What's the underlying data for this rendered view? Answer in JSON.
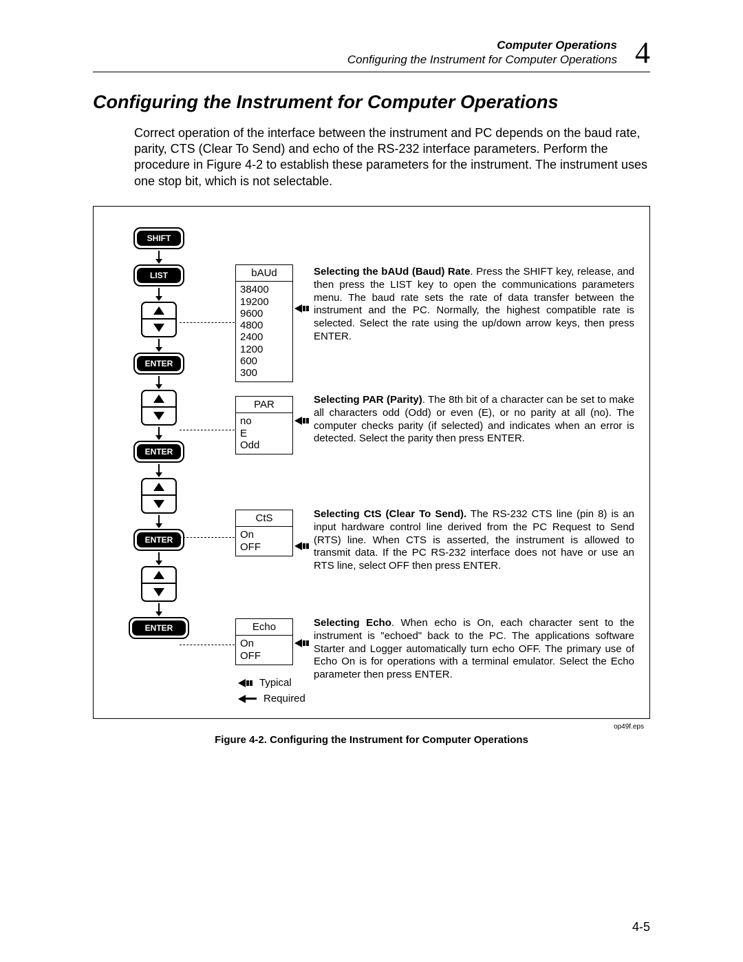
{
  "header": {
    "chapter_title": "Computer Operations",
    "section_line": "Configuring the Instrument for Computer Operations",
    "chapter_number": "4"
  },
  "section_title": "Configuring the Instrument for Computer Operations",
  "intro_text": "Correct operation of the interface between the instrument and PC depends on the baud rate, parity, CTS (Clear To Send) and echo of the RS-232 interface parameters. Perform the procedure in Figure 4-2 to establish these parameters for the instrument. The instrument uses one stop bit, which is not selectable.",
  "keys": {
    "shift": "SHIFT",
    "list": "LIST",
    "enter": "ENTER"
  },
  "options": {
    "baud": {
      "title": "bAUd",
      "values": "38400\n19200\n9600\n4800\n2400\n1200\n600\n300"
    },
    "par": {
      "title": "PAR",
      "values": "no\nE\nOdd"
    },
    "cts": {
      "title": "CtS",
      "values": "On\nOFF"
    },
    "echo": {
      "title": "Echo",
      "values": "On\nOFF"
    }
  },
  "descriptions": {
    "baud_bold": "Selecting the bAUd (Baud) Rate",
    "baud_text": ".  Press the SHIFT key, release, and then press the LIST key to open the communications parameters menu. The baud rate sets the rate of data transfer between the instrument and the PC.  Normally, the highest compatible rate is selected.  Select the rate using the up/down arrow keys, then press ENTER.",
    "par_bold": "Selecting PAR (Parity)",
    "par_text": ".   The 8th bit of a character can be set to make all characters odd (Odd) or even (E), or no parity at all (no).  The computer checks parity (if selected) and indicates when an error is detected.  Select the parity then press ENTER.",
    "cts_bold": "Selecting CtS (Clear To Send).",
    "cts_text": "  The RS-232 CTS line (pin 8) is an input hardware control line derived from the PC Request to Send (RTS) line. When CTS is asserted, the instrument is allowed to transmit data.   If the PC RS-232 interface does not have or use an RTS line, select OFF then press ENTER.",
    "echo_bold": "Selecting Echo",
    "echo_text": ".   When echo is On, each character sent to the instrument is \"echoed\" back to the PC.   The applications software Starter and Logger automatically turn echo OFF.  The primary use of Echo On is for operations with a terminal emulator.  Select the Echo parameter then press ENTER."
  },
  "legend": {
    "typical": "Typical",
    "required": "Required"
  },
  "eps_label": "op49f.eps",
  "figure_caption": "Figure 4-2. Configuring the Instrument for Computer Operations",
  "page_number": "4-5"
}
